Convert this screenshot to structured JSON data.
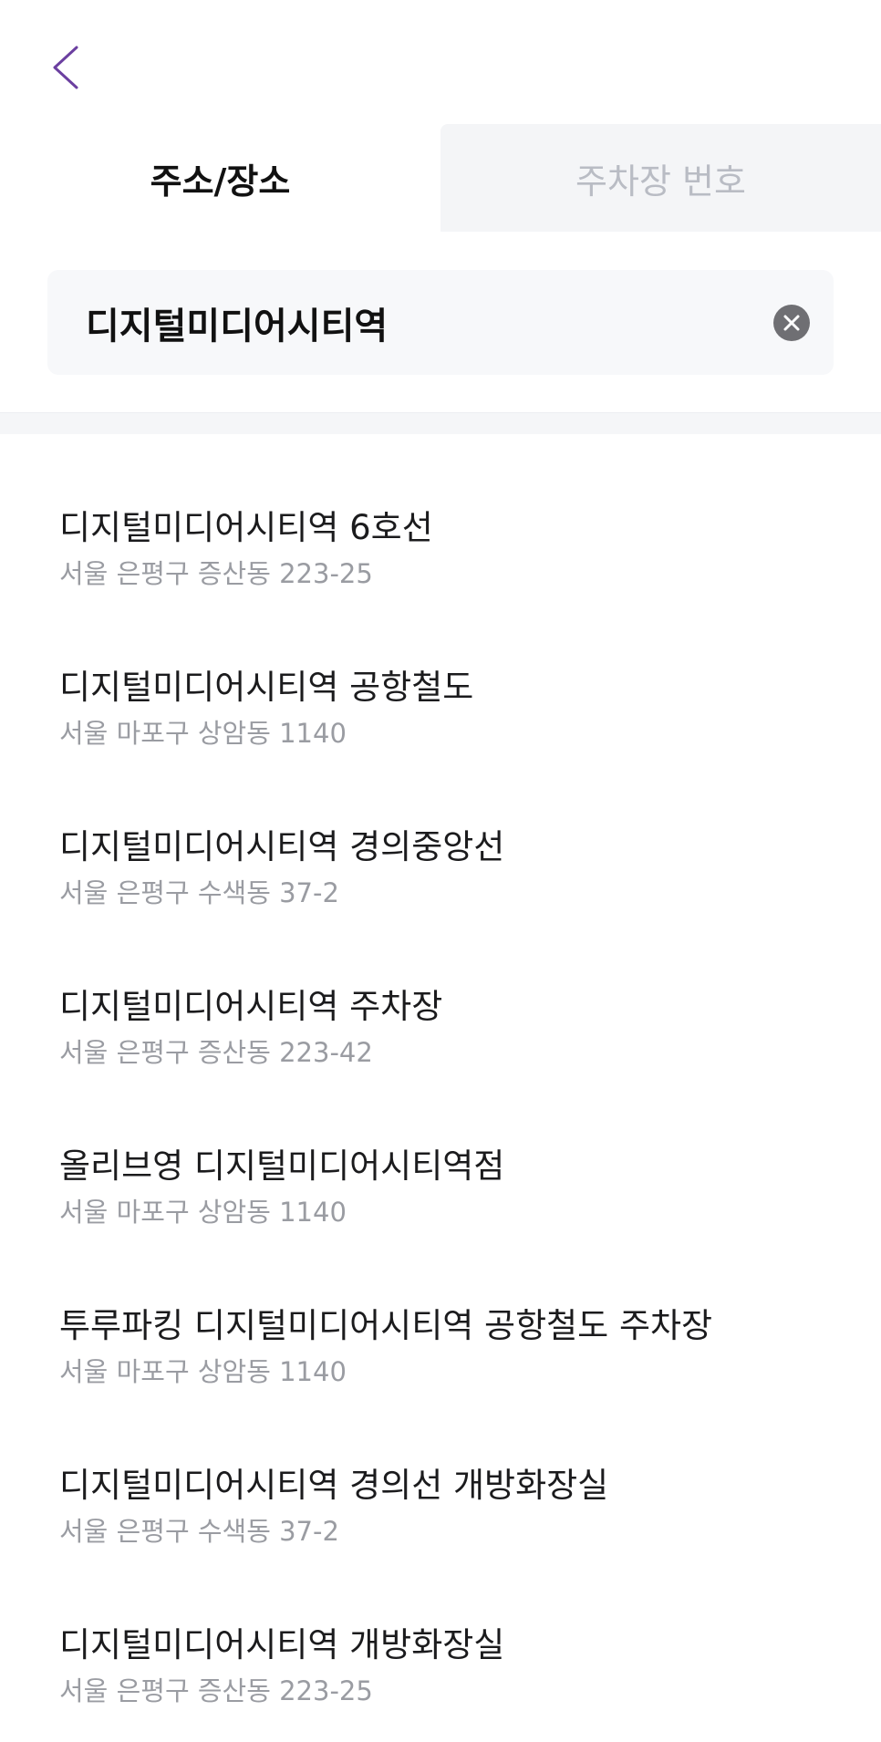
{
  "colors": {
    "accent": "#6b3fa0",
    "inactive_tab_bg": "#f4f5f7",
    "inactive_tab_text": "#b9bcc4",
    "search_bg": "#f7f8fa",
    "clear_button_bg": "#6f6f73",
    "address_text": "#9a9ca2"
  },
  "header": {
    "back_icon": "chevron-left-icon"
  },
  "tabs": [
    {
      "label": "주소/장소",
      "active": true
    },
    {
      "label": "주차장 번호",
      "active": false
    }
  ],
  "search": {
    "value": "디지털미디어시티역",
    "clear_icon": "close-circle-icon"
  },
  "results": [
    {
      "title": "디지털미디어시티역 6호선",
      "address": "서울 은평구 증산동 223-25"
    },
    {
      "title": "디지털미디어시티역 공항철도",
      "address": "서울 마포구 상암동 1140"
    },
    {
      "title": "디지털미디어시티역 경의중앙선",
      "address": "서울 은평구 수색동 37-2"
    },
    {
      "title": "디지털미디어시티역 주차장",
      "address": "서울 은평구 증산동 223-42"
    },
    {
      "title": "올리브영 디지털미디어시티역점",
      "address": "서울 마포구 상암동 1140"
    },
    {
      "title": "투루파킹 디지털미디어시티역 공항철도 주차장",
      "address": "서울 마포구 상암동 1140"
    },
    {
      "title": "디지털미디어시티역 경의선 개방화장실",
      "address": "서울 은평구 수색동 37-2"
    },
    {
      "title": "디지털미디어시티역 개방화장실",
      "address": "서울 은평구 증산동 223-25"
    }
  ]
}
